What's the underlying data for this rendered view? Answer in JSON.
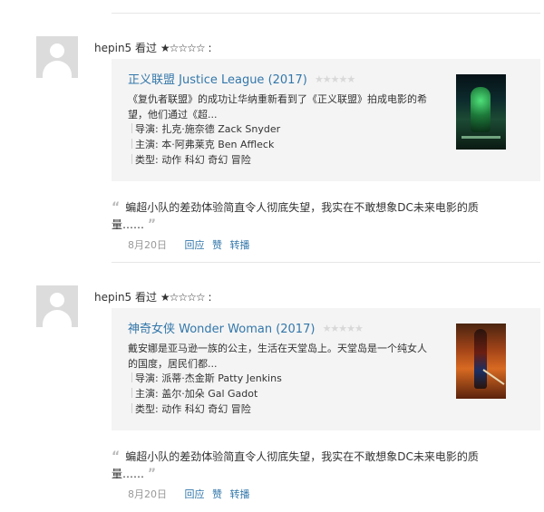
{
  "entries": [
    {
      "user": "hepin5",
      "action": "看过",
      "user_stars": "★☆☆☆☆",
      "colon": ":",
      "title": "正义联盟 Justice League (2017)",
      "rating_stars": "★★★★★",
      "description": "《复仇者联盟》的成功让华纳重新看到了《正义联盟》拍成电影的希望，他们通过《超...",
      "director": "导演: 扎克·施奈德 Zack Snyder",
      "cast": "主演: 本·阿弗莱克 Ben Affleck",
      "genre": "类型: 动作 科幻 奇幻 冒险",
      "poster_icon": "justice-league-poster",
      "quote_open": "“",
      "quote_close": "”",
      "comment": "蝙超小队的差劲体验简直令人彻底失望，我实在不敢想象DC未来电影的质量……",
      "date": "8月20日",
      "actions": [
        "回应",
        "赞",
        "转播"
      ]
    },
    {
      "user": "hepin5",
      "action": "看过",
      "user_stars": "★☆☆☆☆",
      "colon": ":",
      "title": "神奇女侠 Wonder Woman (2017)",
      "rating_stars": "★★★★★",
      "description": "戴安娜是亚马逊一族的公主，生活在天堂岛上。天堂岛是一个纯女人的国度，居民们都...",
      "director": "导演: 派蒂·杰金斯 Patty Jenkins",
      "cast": "主演: 盖尔·加朵 Gal Gadot",
      "genre": "类型: 动作 科幻 奇幻 冒险",
      "poster_icon": "wonder-woman-poster",
      "quote_open": "“",
      "quote_close": "”",
      "comment": "蝙超小队的差劲体验简直令人彻底失望，我实在不敢想象DC未来电影的质量……",
      "date": "8月20日",
      "actions": [
        "回应",
        "赞",
        "转播"
      ]
    }
  ]
}
